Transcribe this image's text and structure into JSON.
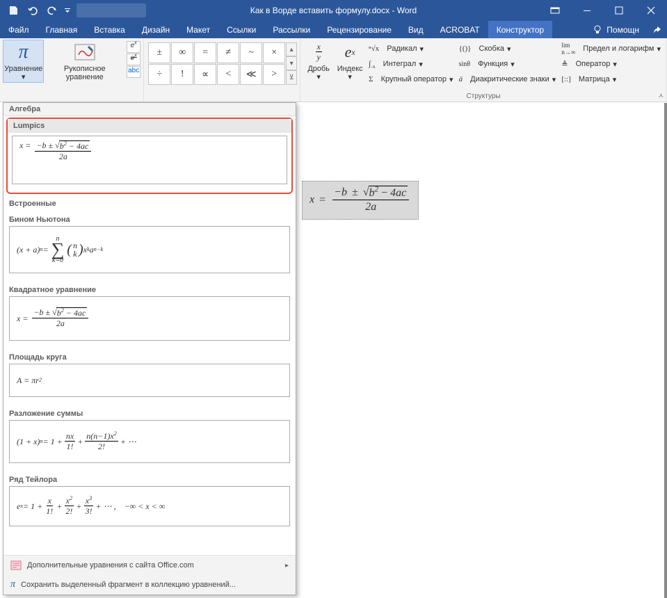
{
  "title": "Как в Ворде вставить формулу.docx - Word",
  "tabs": {
    "file": "Файл",
    "home": "Главная",
    "insert": "Вставка",
    "design": "Дизайн",
    "layout": "Макет",
    "references": "Ссылки",
    "mailings": "Рассылки",
    "review": "Рецензирование",
    "view": "Вид",
    "acrobat": "ACROBAT",
    "constructor": "Конструктор",
    "help": "Помощн"
  },
  "ribbon": {
    "equation": "Уравнение",
    "ink": "Рукописное уравнение",
    "abc": "abc",
    "symbols": [
      "±",
      "∞",
      "=",
      "≠",
      "~",
      "×",
      "÷",
      "!",
      "∝",
      "<",
      "≪",
      ">"
    ],
    "frac": "Дробь",
    "index": "Индекс",
    "radical": "Радикал",
    "integral": "Интеграл",
    "large_op": "Крупный оператор",
    "bracket": "Скобка",
    "function": "Функция",
    "diacritics": "Диакритические знаки",
    "limit": "Предел и логарифм",
    "operator": "Оператор",
    "matrix": "Матрица",
    "group_struct": "Структуры"
  },
  "gallery": {
    "head": "Алгебра",
    "lumpics": "Lumpics",
    "builtin": "Встроенные",
    "binom": "Бином Ньютона",
    "quad": "Квадратное уравнение",
    "circle": "Площадь круга",
    "sum_expand": "Разложение суммы",
    "taylor": "Ряд Тейлора",
    "more_office": "Дополнительные уравнения с сайта Office.com",
    "save_sel": "Сохранить выделенный фрагмент в коллекцию уравнений..."
  },
  "doc_eq": {
    "x": "x",
    "eq": "=",
    "neg_b": "−b",
    "pm": "±",
    "b2": "b",
    "minus": "−",
    "four_ac": "4ac",
    "two_a": "2a"
  }
}
